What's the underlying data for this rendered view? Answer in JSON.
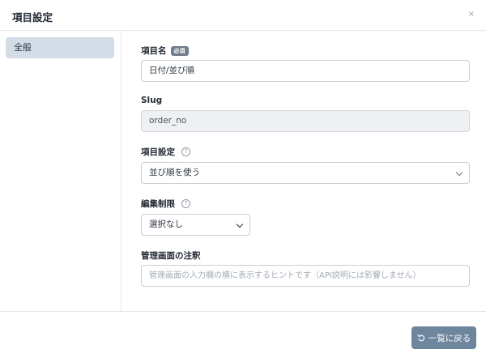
{
  "dialog": {
    "title": "項目設定",
    "close_glyph": "×"
  },
  "sidebar": {
    "items": [
      {
        "label": "全般"
      }
    ]
  },
  "fields": {
    "name": {
      "label": "項目名",
      "badge": "必須",
      "value": "日付/並び順"
    },
    "slug": {
      "label": "Slug",
      "value": "order_no"
    },
    "setting": {
      "label": "項目設定",
      "help": "?",
      "selected": "並び順を使う"
    },
    "edit_limit": {
      "label": "編集制限",
      "help": "?",
      "selected": "選択なし"
    },
    "note": {
      "label": "管理画面の注釈",
      "placeholder": "管理画面の入力欄の横に表示するヒントです（API説明には影響しません）"
    }
  },
  "footer": {
    "back_label": "一覧に戻る"
  }
}
